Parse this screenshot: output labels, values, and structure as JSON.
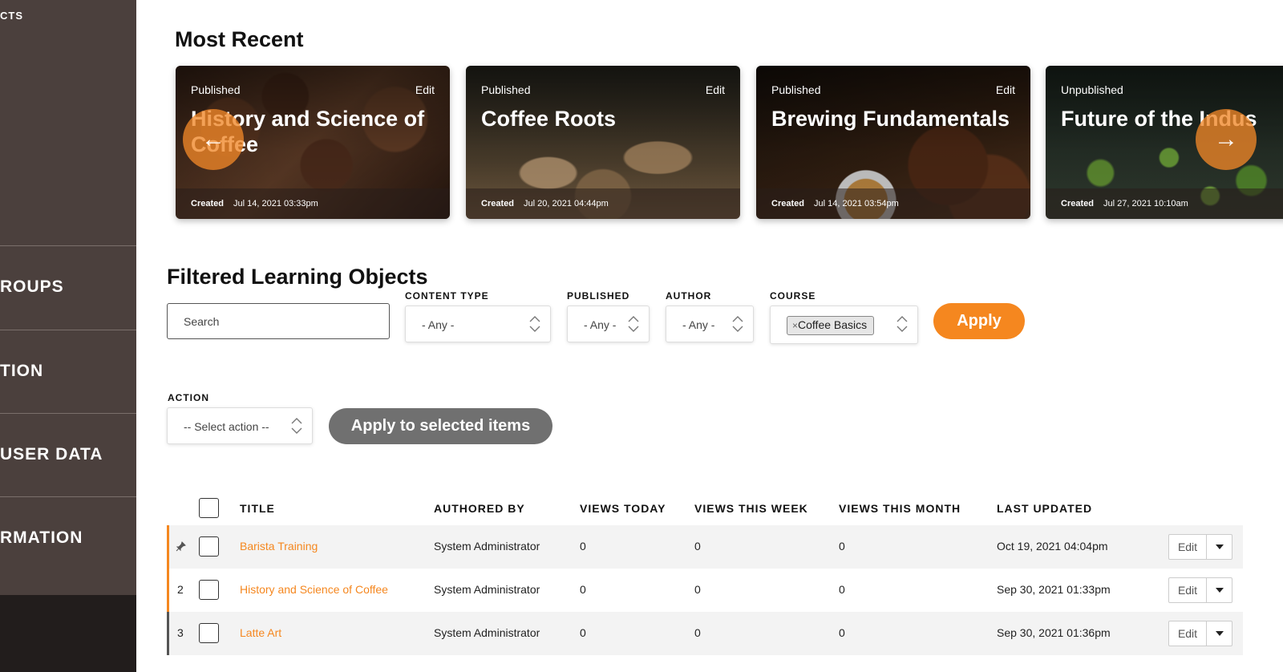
{
  "sidebar": {
    "items": [
      {
        "label": "CTS"
      },
      {
        "label": "ROUPS"
      },
      {
        "label": "TION"
      },
      {
        "label": "USER DATA"
      },
      {
        "label": "RMATION"
      }
    ]
  },
  "most_recent": {
    "heading": "Most Recent",
    "cards": [
      {
        "status": "Published",
        "edit": "Edit",
        "title": "History and Science of Coffee",
        "created_label": "Created",
        "created_date": "Jul 14, 2021 03:33pm"
      },
      {
        "status": "Published",
        "edit": "Edit",
        "title": "Coffee Roots",
        "created_label": "Created",
        "created_date": "Jul 20, 2021 04:44pm"
      },
      {
        "status": "Published",
        "edit": "Edit",
        "title": "Brewing Fundamentals",
        "created_label": "Created",
        "created_date": "Jul 14, 2021 03:54pm"
      },
      {
        "status": "Unpublished",
        "edit": "",
        "title": "Future of the Indus",
        "created_label": "Created",
        "created_date": "Jul 27, 2021 10:10am"
      }
    ]
  },
  "filters": {
    "heading": "Filtered Learning Objects",
    "search_placeholder": "Search",
    "content_type": {
      "label": "CONTENT TYPE",
      "value": "- Any -"
    },
    "published": {
      "label": "PUBLISHED",
      "value": "- Any -"
    },
    "author": {
      "label": "AUTHOR",
      "value": "- Any -"
    },
    "course": {
      "label": "COURSE",
      "chip": "Coffee Basics",
      "chip_remove": "×"
    },
    "apply": "Apply"
  },
  "action": {
    "label": "ACTION",
    "select_value": "-- Select action --",
    "apply_selected": "Apply to selected items"
  },
  "table": {
    "headers": {
      "title": "TITLE",
      "authored_by": "AUTHORED BY",
      "views_today": "VIEWS TODAY",
      "views_week": "VIEWS THIS WEEK",
      "views_month": "VIEWS THIS MONTH",
      "last_updated": "LAST UPDATED"
    },
    "rows": [
      {
        "index": "",
        "title": "Barista Training",
        "author": "System Administrator",
        "today": "0",
        "week": "0",
        "month": "0",
        "updated": "Oct 19, 2021 04:04pm",
        "edit": "Edit"
      },
      {
        "index": "2",
        "title": "History and Science of Coffee",
        "author": "System Administrator",
        "today": "0",
        "week": "0",
        "month": "0",
        "updated": "Sep 30, 2021 01:33pm",
        "edit": "Edit"
      },
      {
        "index": "3",
        "title": "Latte Art",
        "author": "System Administrator",
        "today": "0",
        "week": "0",
        "month": "0",
        "updated": "Sep 30, 2021 01:36pm",
        "edit": "Edit"
      }
    ]
  },
  "colors": {
    "accent": "#f5871f",
    "sidebar": "#4b403d",
    "sidebar_dark": "#221d1c"
  }
}
